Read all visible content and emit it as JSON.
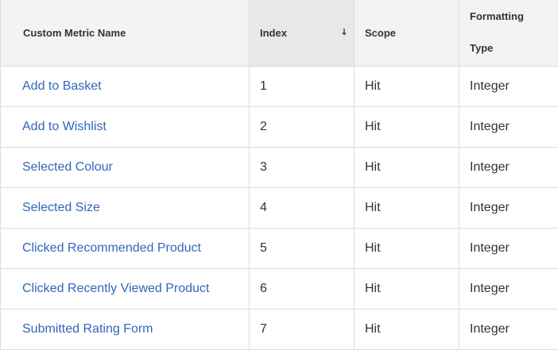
{
  "table": {
    "headers": {
      "name": "Custom Metric Name",
      "index": "Index",
      "scope": "Scope",
      "formatting_line1": "Formatting",
      "formatting_line2": "Type"
    },
    "sort": {
      "column": "index",
      "direction": "descending"
    },
    "rows": [
      {
        "name": "Add to Basket",
        "index": "1",
        "scope": "Hit",
        "type": "Integer"
      },
      {
        "name": "Add to Wishlist",
        "index": "2",
        "scope": "Hit",
        "type": "Integer"
      },
      {
        "name": "Selected Colour",
        "index": "3",
        "scope": "Hit",
        "type": "Integer"
      },
      {
        "name": "Selected Size",
        "index": "4",
        "scope": "Hit",
        "type": "Integer"
      },
      {
        "name": "Clicked Recommended Product",
        "index": "5",
        "scope": "Hit",
        "type": "Integer"
      },
      {
        "name": "Clicked Recently Viewed Product",
        "index": "6",
        "scope": "Hit",
        "type": "Integer"
      },
      {
        "name": "Submitted Rating Form",
        "index": "7",
        "scope": "Hit",
        "type": "Integer"
      }
    ]
  },
  "colors": {
    "link": "#3167b8",
    "header_bg": "#f3f3f3",
    "sorted_header_bg": "#e8e8e8",
    "border": "#dcdcdc"
  },
  "icons": {
    "sort": "arrow-down-icon"
  }
}
